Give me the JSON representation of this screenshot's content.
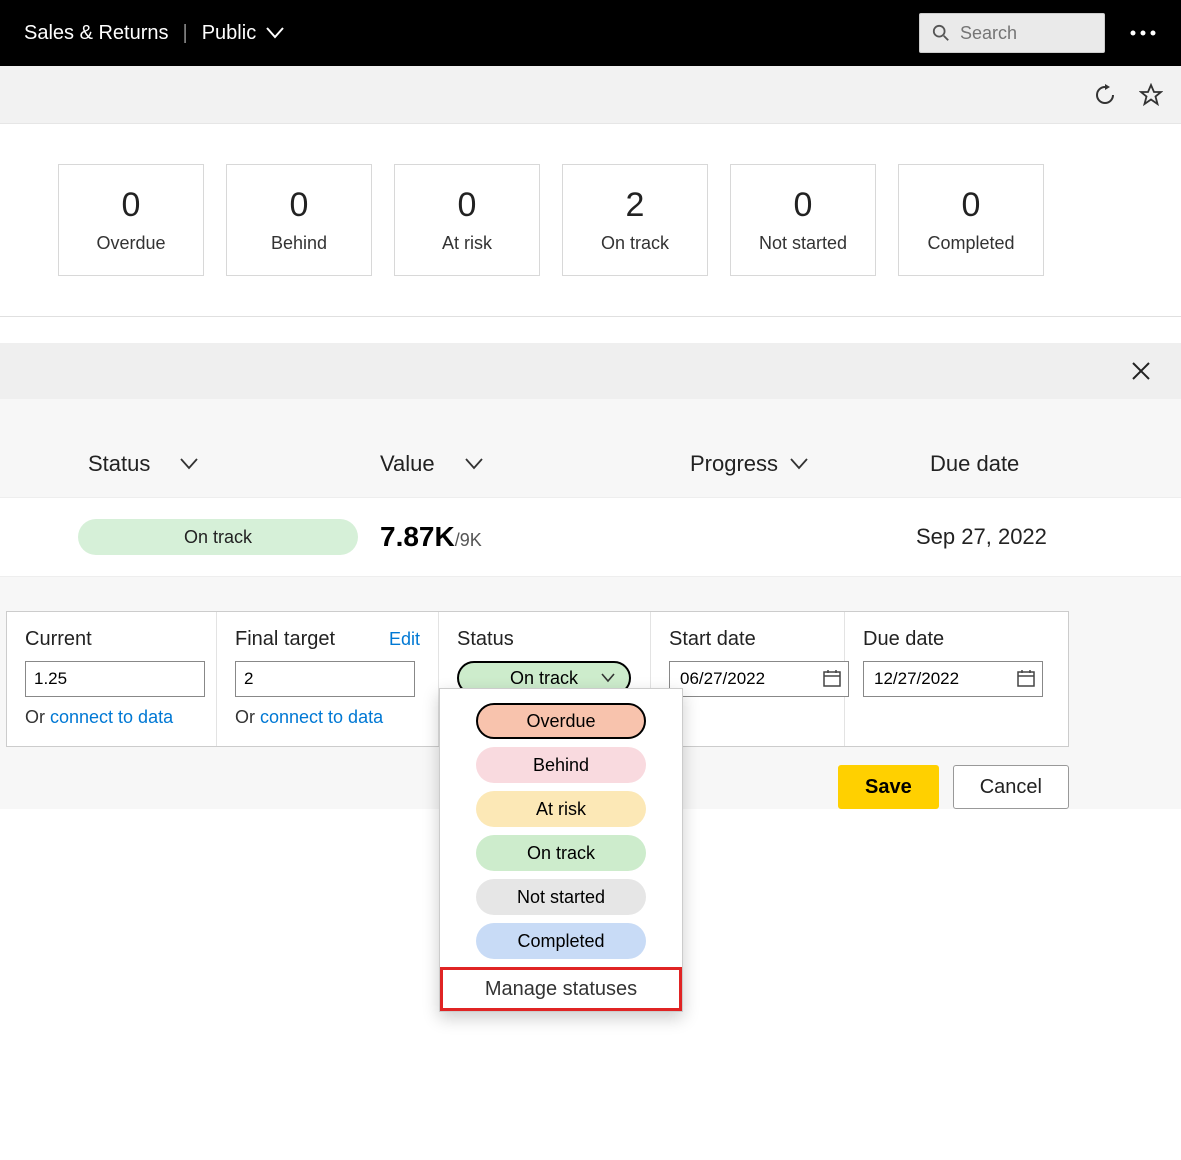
{
  "topbar": {
    "title": "Sales & Returns",
    "separator": "|",
    "scope": "Public",
    "search_placeholder": "Search",
    "more_label": "…"
  },
  "summary_cards": [
    {
      "value": "0",
      "label": "Overdue"
    },
    {
      "value": "0",
      "label": "Behind"
    },
    {
      "value": "0",
      "label": "At risk"
    },
    {
      "value": "2",
      "label": "On track"
    },
    {
      "value": "0",
      "label": "Not started"
    },
    {
      "value": "0",
      "label": "Completed"
    }
  ],
  "columns": {
    "status": "Status",
    "value": "Value",
    "progress": "Progress",
    "due_date": "Due date"
  },
  "row": {
    "status_pill": "On track",
    "value_main": "7.87K",
    "value_denom": "/9K",
    "due_date": "Sep 27, 2022"
  },
  "form": {
    "current_label": "Current",
    "current_value": "1.25",
    "target_label": "Final target",
    "target_value": "2",
    "edit_label": "Edit",
    "status_label": "Status",
    "status_selected": "On track",
    "connect_prefix": "Or ",
    "connect_link": "connect to data",
    "start_label": "Start date",
    "start_value": "06/27/2022",
    "due_label": "Due date",
    "due_value": "12/27/2022"
  },
  "status_options": {
    "overdue": "Overdue",
    "behind": "Behind",
    "at_risk": "At risk",
    "on_track": "On track",
    "not_started": "Not started",
    "completed": "Completed",
    "manage": "Manage statuses"
  },
  "actions": {
    "save": "Save",
    "cancel": "Cancel"
  },
  "colors": {
    "overdue": "#f8c3ad",
    "behind": "#f9dadf",
    "at_risk": "#fce8b6",
    "on_track": "#cdeccc",
    "not_started": "#e6e6e6",
    "completed": "#c8dbf6",
    "accent": "#ffd000",
    "highlight_border": "#e02424"
  }
}
